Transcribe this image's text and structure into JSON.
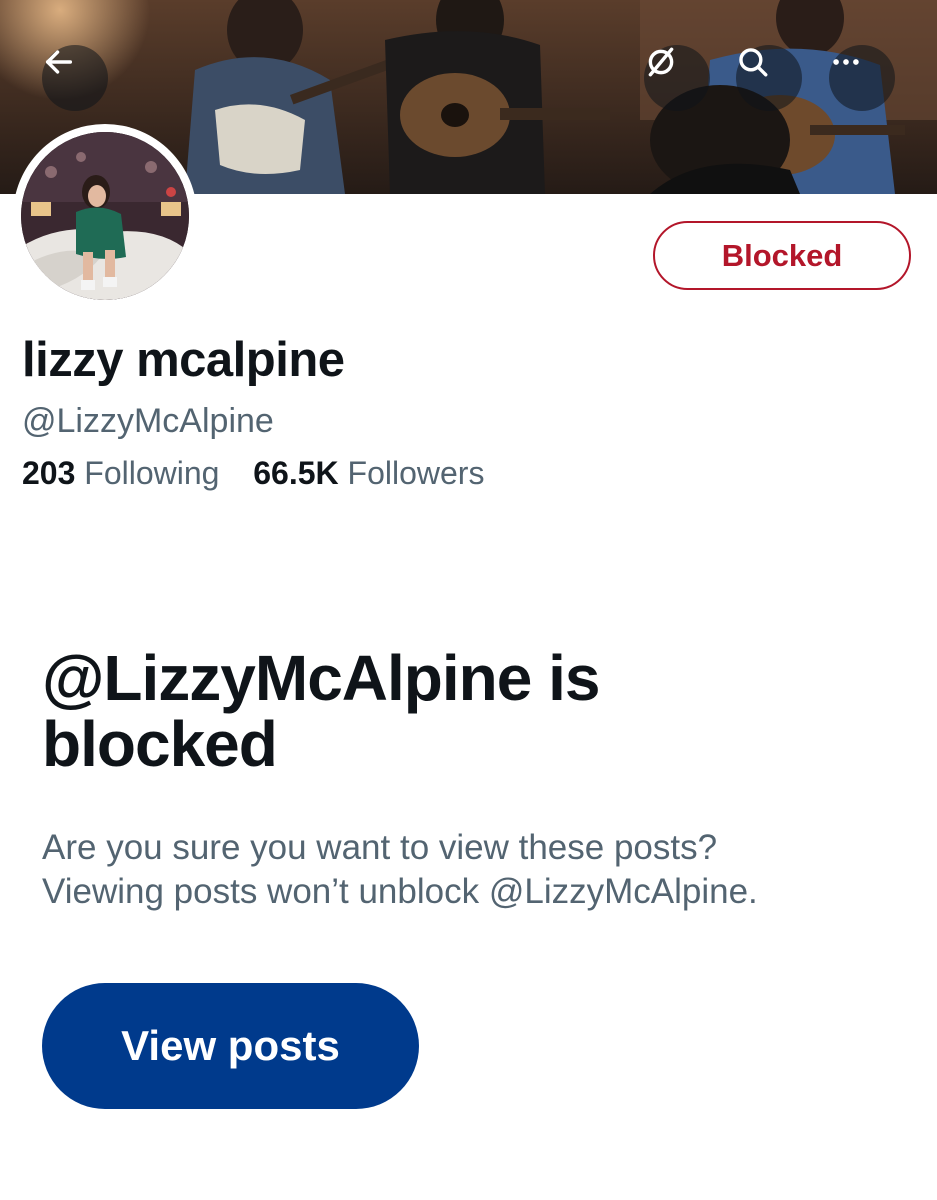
{
  "header": {
    "back_icon": "arrow-left-icon",
    "translate_icon": "disabled-circle-icon",
    "search_icon": "search-icon",
    "more_icon": "more-horizontal-icon"
  },
  "profile": {
    "display_name": "lizzy mcalpine",
    "handle": "@LizzyMcAlpine",
    "following_count": "203",
    "following_label": "Following",
    "followers_count": "66.5K",
    "followers_label": "Followers",
    "action_button_label": "Blocked"
  },
  "blocked_notice": {
    "title_line1": "@LizzyMcAlpine is",
    "title_line2": "blocked",
    "desc_line1": "Are you sure you want to view these posts?",
    "desc_line2": "Viewing posts won’t unblock @LizzyMcAlpine.",
    "view_button_label": "View posts"
  },
  "colors": {
    "blocked_red": "#b3162a",
    "view_button_blue": "#003a8c",
    "secondary_text": "#536471",
    "primary_text": "#0f1419"
  }
}
